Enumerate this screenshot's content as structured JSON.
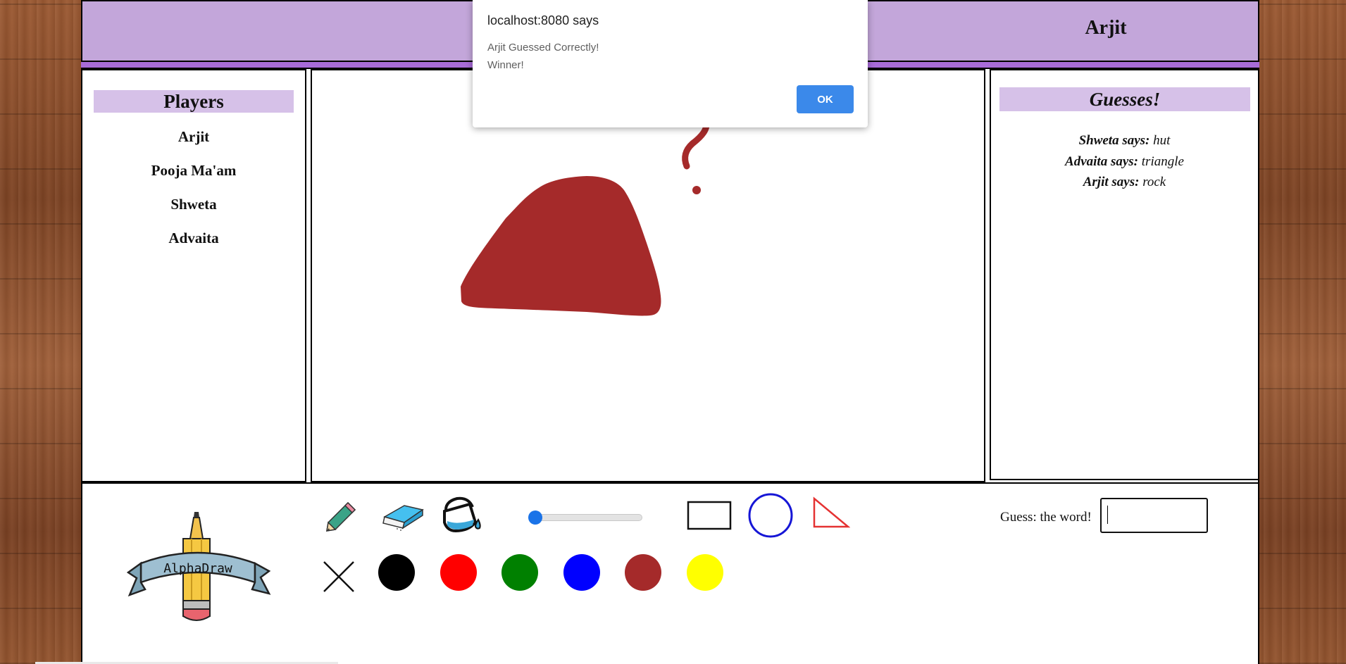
{
  "header": {
    "current_player": "Arjit"
  },
  "players_panel": {
    "title": "Players",
    "players": [
      "Arjit",
      "Pooja Ma'am",
      "Shweta",
      "Advaita"
    ]
  },
  "guesses_panel": {
    "title": "Guesses!",
    "guesses": [
      {
        "who": "Shweta says:",
        "word": "hut"
      },
      {
        "who": "Advaita says:",
        "word": "triangle"
      },
      {
        "who": "Arjit says:",
        "word": "rock"
      }
    ]
  },
  "logo": {
    "text": "AlphaDraw"
  },
  "tools": [
    "pencil-icon",
    "eraser-icon",
    "fill-bucket-icon",
    "brush-size-slider",
    "rectangle-tool",
    "circle-tool",
    "triangle-tool",
    "clear-x-icon"
  ],
  "colors": [
    "#000000",
    "#ff0000",
    "#008000",
    "#0000ff",
    "#a52a2a",
    "#ffff00"
  ],
  "guess": {
    "label": "Guess: the word!",
    "value": ""
  },
  "dialog": {
    "title": "localhost:8080 says",
    "line1": "Arjit Guessed Correctly!",
    "line2": "Winner!",
    "ok_label": "OK"
  }
}
